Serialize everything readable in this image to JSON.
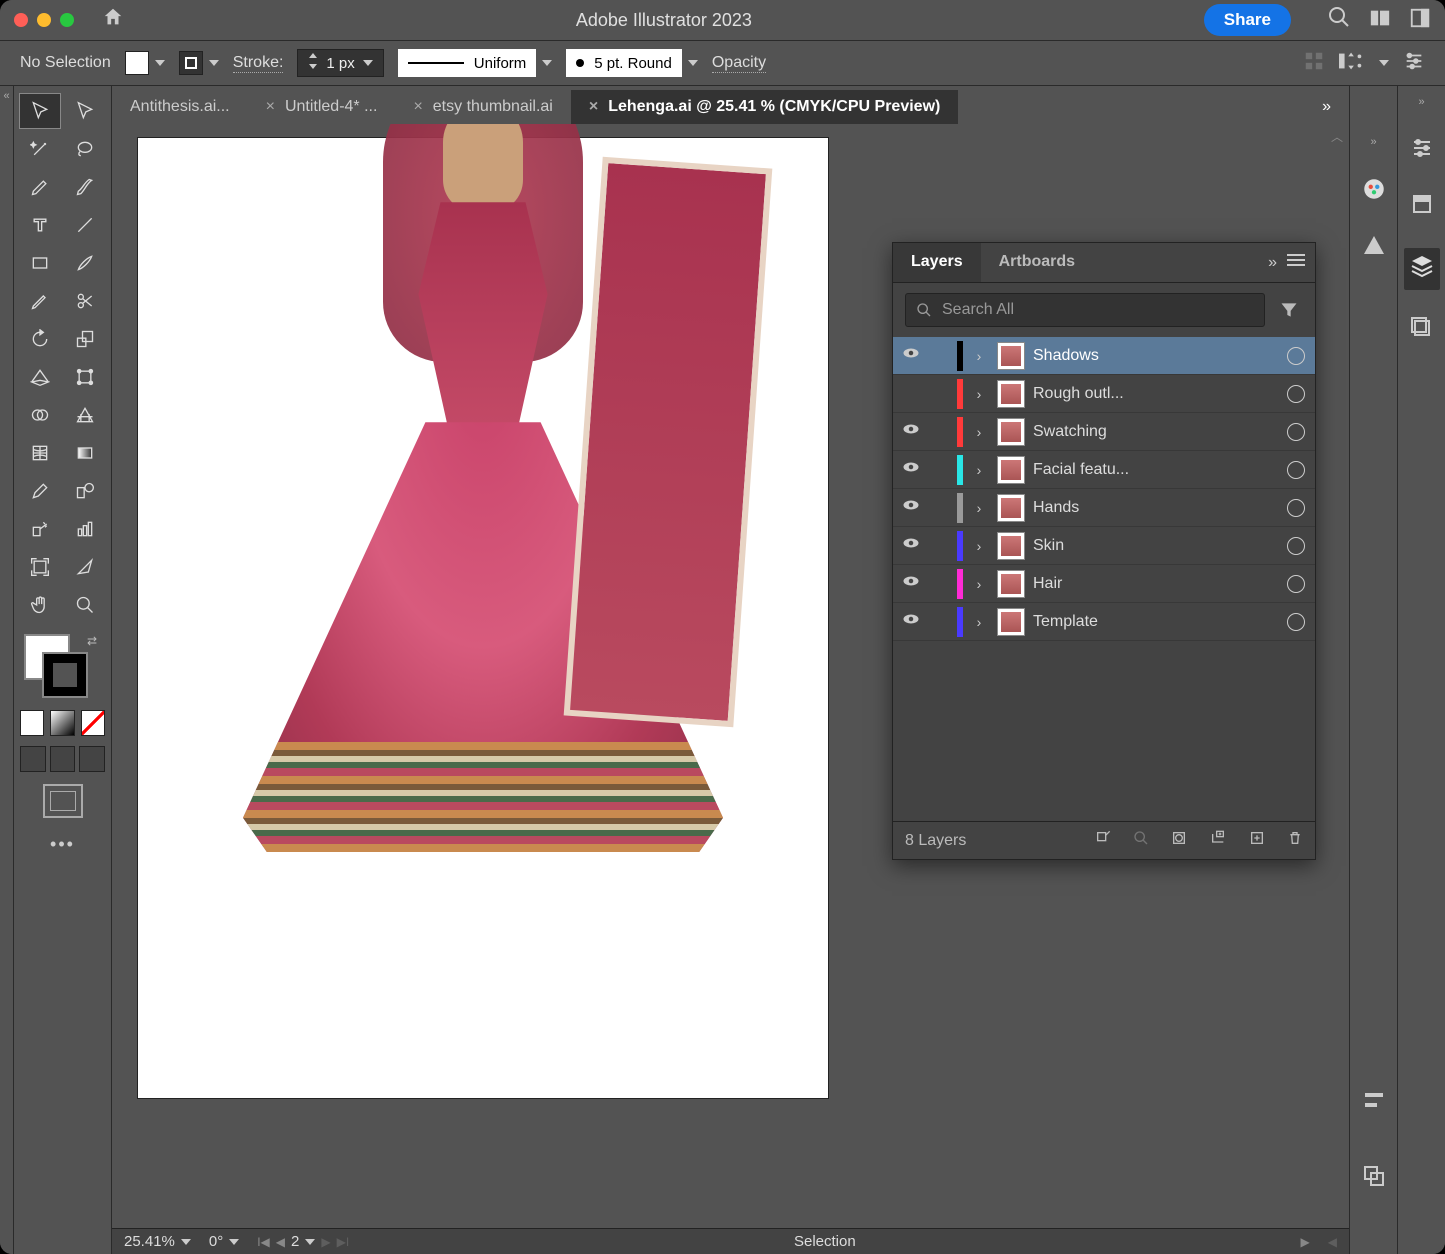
{
  "titlebar": {
    "app_title": "Adobe Illustrator 2023",
    "share_label": "Share"
  },
  "options": {
    "selection_state": "No Selection",
    "stroke_label": "Stroke:",
    "stroke_value": "1 px",
    "profile_label": "Uniform",
    "brush_label": "5 pt. Round",
    "opacity_label": "Opacity"
  },
  "tabs": [
    {
      "label": "Antithesis.ai...",
      "active": false,
      "closeable": false
    },
    {
      "label": "Untitled-4* ...",
      "active": false,
      "closeable": true
    },
    {
      "label": "etsy thumbnail.ai",
      "active": false,
      "closeable": true
    },
    {
      "label": "Lehenga.ai @ 25.41 % (CMYK/CPU Preview)",
      "active": true,
      "closeable": true
    }
  ],
  "status": {
    "zoom": "25.41%",
    "rotate": "0°",
    "artboard_index": "2",
    "mode": "Selection"
  },
  "layers_panel": {
    "tab_layers": "Layers",
    "tab_artboards": "Artboards",
    "search_placeholder": "Search All",
    "footer_count": "8 Layers",
    "layers": [
      {
        "name": "Shadows",
        "color": "#000000",
        "visible": true,
        "selected": true
      },
      {
        "name": "Rough outl...",
        "color": "#ff3a3a",
        "visible": false,
        "selected": false
      },
      {
        "name": "Swatching",
        "color": "#ff3a3a",
        "visible": true,
        "selected": false
      },
      {
        "name": "Facial featu...",
        "color": "#29e6e6",
        "visible": true,
        "selected": false
      },
      {
        "name": "Hands",
        "color": "#9a9a9a",
        "visible": true,
        "selected": false
      },
      {
        "name": "Skin",
        "color": "#4a3aff",
        "visible": true,
        "selected": false
      },
      {
        "name": "Hair",
        "color": "#ff2bd6",
        "visible": true,
        "selected": false
      },
      {
        "name": "Template",
        "color": "#4a3aff",
        "visible": true,
        "selected": false
      }
    ]
  }
}
